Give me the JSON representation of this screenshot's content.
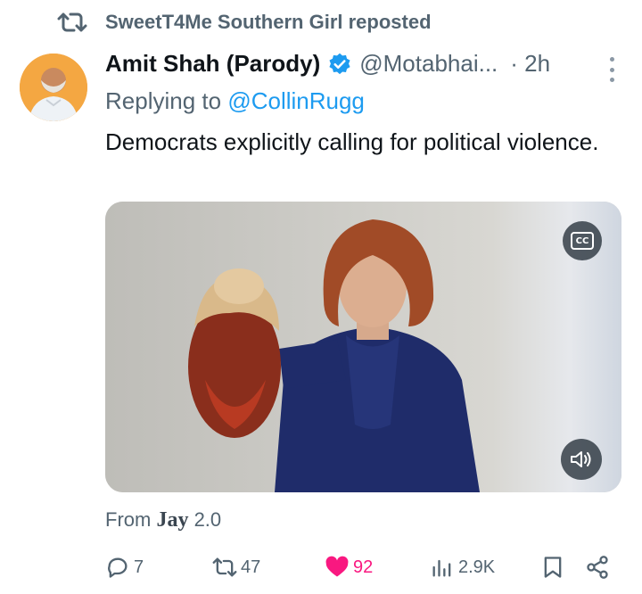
{
  "repost": {
    "text": "SweetT4Me Southern Girl reposted"
  },
  "tweet": {
    "author_name": "Amit Shah (Parody)",
    "handle": "@Motabhai...",
    "time": "· 2h",
    "replying_prefix": "Replying to ",
    "replying_to": "@CollinRugg",
    "text": "Democrats explicitly calling for political violence."
  },
  "media": {
    "cc_label": "CC"
  },
  "source": {
    "prefix": "From ",
    "app_name": "Jay",
    "app_version": " 2.0"
  },
  "actions": {
    "replies": "7",
    "reposts": "47",
    "likes": "92",
    "views": "2.9K"
  },
  "colors": {
    "accent": "#1d9bf0",
    "like": "#f91880",
    "muted": "#536471"
  }
}
